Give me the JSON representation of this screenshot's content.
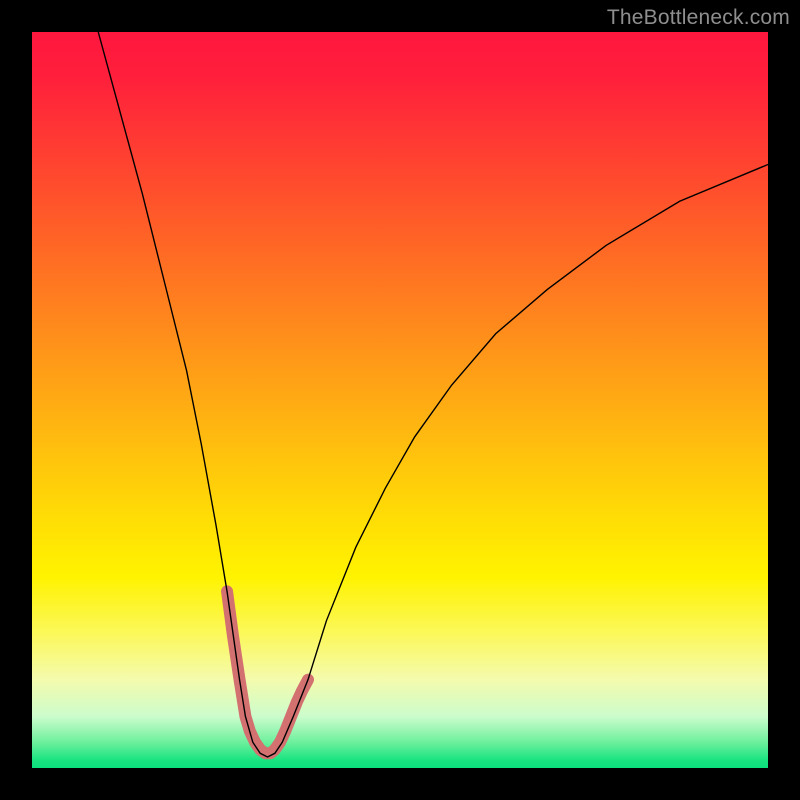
{
  "watermark": {
    "text": "TheBottleneck.com"
  },
  "chart_data": {
    "type": "line",
    "title": "",
    "xlabel": "",
    "ylabel": "",
    "xlim": [
      0,
      100
    ],
    "ylim": [
      0,
      100
    ],
    "series": [
      {
        "name": "curve",
        "x": [
          9,
          12,
          15,
          18,
          21,
          23,
          25,
          26.5,
          28.2,
          29,
          30,
          31,
          32,
          33,
          34,
          35.5,
          37.5,
          40,
          44,
          48,
          52,
          57,
          63,
          70,
          78,
          88,
          100
        ],
        "y": [
          100,
          89,
          78,
          66,
          54,
          44,
          33,
          24,
          12,
          7,
          3.5,
          2,
          1.5,
          2,
          3.5,
          7,
          12,
          20,
          30,
          38,
          45,
          52,
          59,
          65,
          71,
          77,
          82
        ],
        "stroke": "#000000",
        "width": 1.4
      },
      {
        "name": "marker-band",
        "x": [
          26.5,
          27.3,
          28.2,
          29,
          29.6,
          30.3,
          31,
          31.7,
          32.4,
          33,
          33.7,
          34.4,
          35.2,
          36,
          36.7,
          37.5
        ],
        "y": [
          24,
          18,
          12,
          7,
          5,
          3.5,
          2.5,
          2,
          2,
          2.5,
          3.5,
          5,
          7,
          9,
          10.5,
          12
        ],
        "stroke": "#d37171",
        "width": 12,
        "linecap": "round"
      }
    ]
  }
}
